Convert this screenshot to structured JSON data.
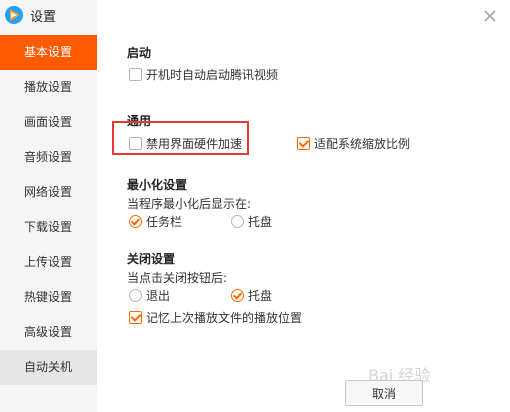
{
  "app": {
    "title": "设置",
    "logo_icon": "tencent-video-logo-icon",
    "accent_color": "#ff5a00"
  },
  "sidebar": {
    "items": [
      {
        "label": "基本设置",
        "active": true
      },
      {
        "label": "播放设置"
      },
      {
        "label": "画面设置"
      },
      {
        "label": "音频设置"
      },
      {
        "label": "网络设置"
      },
      {
        "label": "下载设置"
      },
      {
        "label": "上传设置"
      },
      {
        "label": "热键设置"
      },
      {
        "label": "高级设置"
      },
      {
        "label": "自动关机",
        "hovered": true
      }
    ]
  },
  "startup": {
    "title": "启动",
    "auto_start_label": "开机时自动启动腾讯视频",
    "auto_start_checked": false
  },
  "general": {
    "title": "通用",
    "disable_hw_accel_label": "禁用界面硬件加速",
    "disable_hw_accel_checked": false,
    "adapt_scaling_label": "适配系统缩放比例",
    "adapt_scaling_checked": true
  },
  "minimize": {
    "title": "最小化设置",
    "prompt": "当程序最小化后显示在:",
    "option_taskbar": "任务栏",
    "option_tray": "托盘",
    "selected": "taskbar"
  },
  "close": {
    "title": "关闭设置",
    "prompt": "当点击关闭按钮后:",
    "option_exit": "退出",
    "option_tray": "托盘",
    "selected": "tray",
    "remember_position_label": "记忆上次播放文件的播放位置",
    "remember_position_checked": true
  },
  "footer": {
    "cancel_label": "取消"
  },
  "watermark": {
    "text": "Bai 经验"
  }
}
